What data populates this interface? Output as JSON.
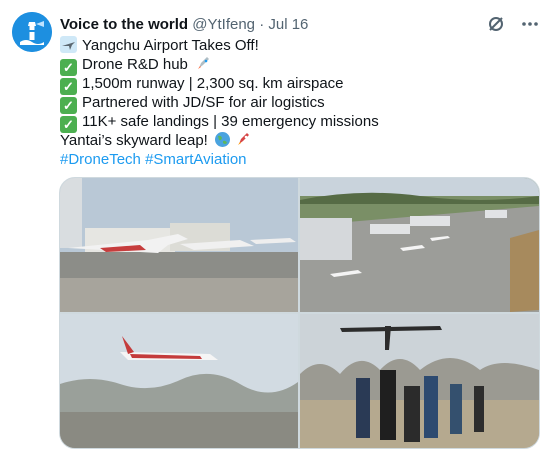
{
  "author": {
    "name": "Voice to the world",
    "handle": "@YtIfeng",
    "separator": "·",
    "date": "Jul 16"
  },
  "header_icons": [
    "grok-icon",
    "more-icon"
  ],
  "body": {
    "line1": "Yangchu Airport Takes Off!",
    "line2": "Drone R&D hub",
    "line3": "1,500m runway | 2,300 sq. km airspace",
    "line4": "Partnered with JD/SF for air logistics",
    "line5": "11K+ safe landings | 39 emergency missions",
    "line6": "Yantai’s skyward leap!",
    "hashtags": [
      "#DroneTech",
      "#SmartAviation"
    ]
  },
  "colors": {
    "link": "#1d9bf0",
    "muted": "#536471",
    "check": "#4caf50"
  },
  "media": [
    {
      "name": "photo-airport-apron"
    },
    {
      "name": "photo-aerial-airfield"
    },
    {
      "name": "photo-plane-in-flight"
    },
    {
      "name": "photo-drone-launch"
    }
  ]
}
